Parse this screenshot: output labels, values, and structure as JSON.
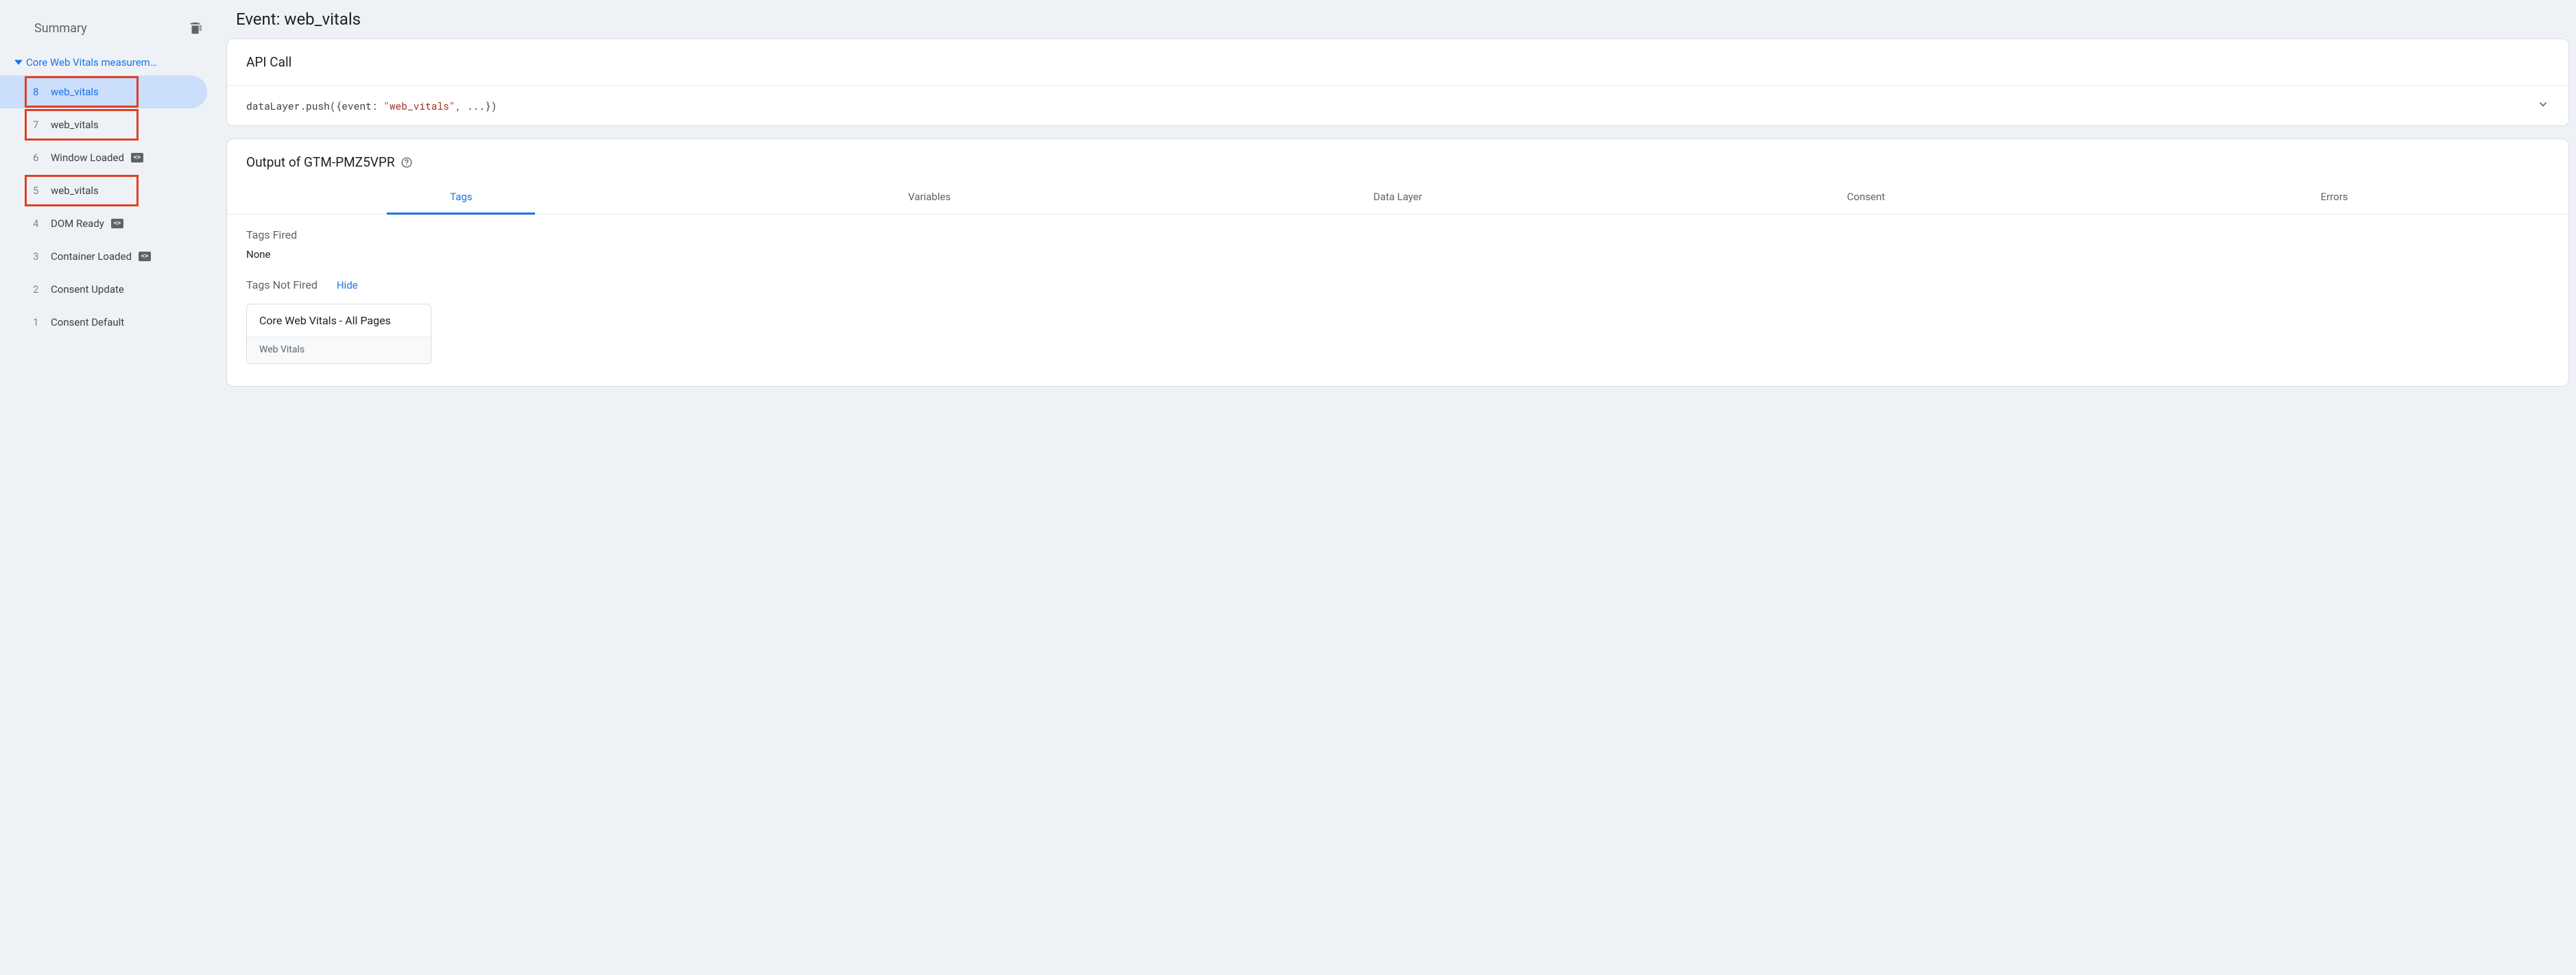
{
  "sidebar": {
    "summary_label": "Summary",
    "group_label": "Core Web Vitals measurem…",
    "items": [
      {
        "index": "8",
        "label": "web_vitals",
        "selected": true,
        "badge": false,
        "highlight": true
      },
      {
        "index": "7",
        "label": "web_vitals",
        "selected": false,
        "badge": false,
        "highlight": true
      },
      {
        "index": "6",
        "label": "Window Loaded",
        "selected": false,
        "badge": true,
        "highlight": false
      },
      {
        "index": "5",
        "label": "web_vitals",
        "selected": false,
        "badge": false,
        "highlight": true
      },
      {
        "index": "4",
        "label": "DOM Ready",
        "selected": false,
        "badge": true,
        "highlight": false
      },
      {
        "index": "3",
        "label": "Container Loaded",
        "selected": false,
        "badge": true,
        "highlight": false
      },
      {
        "index": "2",
        "label": "Consent Update",
        "selected": false,
        "badge": false,
        "highlight": false
      },
      {
        "index": "1",
        "label": "Consent Default",
        "selected": false,
        "badge": false,
        "highlight": false
      }
    ]
  },
  "main": {
    "page_title": "Event: web_vitals",
    "api_call": {
      "header": "API Call",
      "code_prefix": "dataLayer.push({event: ",
      "code_string": "\"web_vitals\"",
      "code_suffix": ", ...})"
    },
    "output": {
      "header": "Output of GTM-PMZ5VPR",
      "tabs": [
        "Tags",
        "Variables",
        "Data Layer",
        "Consent",
        "Errors"
      ],
      "active_tab": 0,
      "fired_label": "Tags Fired",
      "fired_value": "None",
      "not_fired_label": "Tags Not Fired",
      "hide_label": "Hide",
      "not_fired_tag": {
        "name": "Core Web Vitals - All Pages",
        "type": "Web Vitals"
      }
    }
  }
}
